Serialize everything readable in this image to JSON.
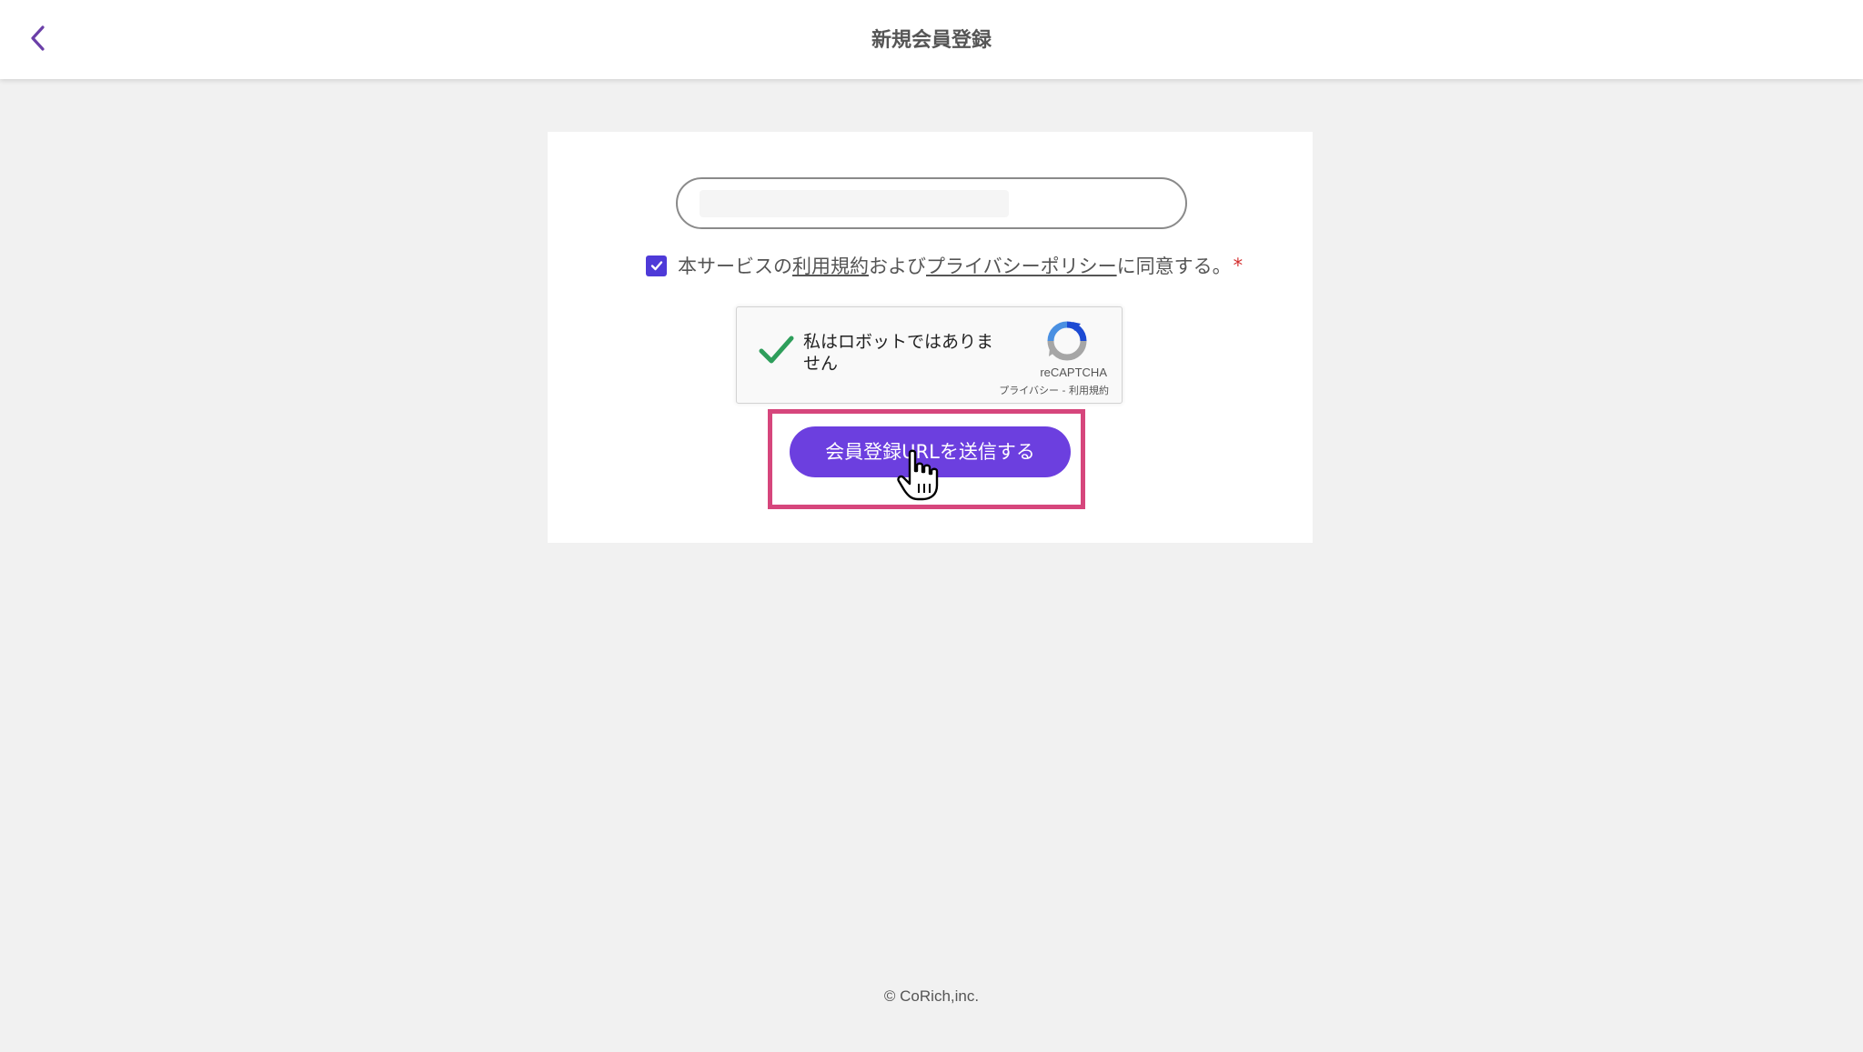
{
  "header": {
    "title": "新規会員登録",
    "back_icon": "chevron-left-icon"
  },
  "form": {
    "email": {
      "value": "",
      "placeholder": ""
    },
    "consent": {
      "prefix": "本サービスの",
      "terms_link": "利用規約",
      "middle": "および",
      "privacy_link": "プライバシーポリシー",
      "suffix": "に同意する。",
      "required_mark": "*",
      "checked": true
    },
    "recaptcha": {
      "label": "私はロボットではありません",
      "brand": "reCAPTCHA",
      "links": "プライバシー - 利用規約",
      "checked": true
    },
    "submit_label": "会員登録URLを送信する"
  },
  "footer": {
    "copyright": "© CoRich,inc."
  },
  "colors": {
    "accent": "#6c3fdf",
    "checkbox": "#4e3ad8",
    "highlight": "#d6467c",
    "required": "#d32f2f",
    "recaptcha_check": "#2e9e5b"
  }
}
